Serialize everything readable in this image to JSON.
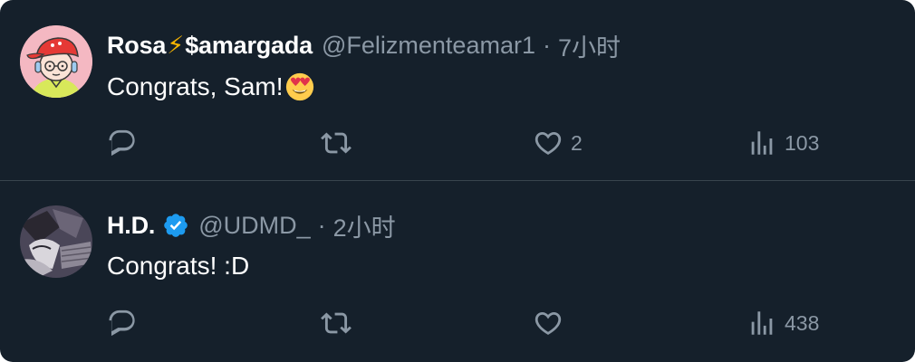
{
  "colors": {
    "background": "#15202b",
    "text_primary": "#ffffff",
    "text_secondary": "#8b98a5",
    "divider": "#38444d",
    "verified_blue": "#1d9bf0"
  },
  "tweets": [
    {
      "name": "Rosa",
      "name_emoji": "⚡",
      "name_suffix": "$amargada",
      "handle": "@Felizmenteamar1",
      "separator": "·",
      "time": "7小时",
      "verified": false,
      "text": "Congrats, Sam!",
      "text_emoji": "heart-eyes-emoji",
      "actions": {
        "reply_icon": "reply-icon",
        "retweet_icon": "retweet-icon",
        "like_icon": "heart-icon",
        "like_count": "2",
        "views_icon": "views-icon",
        "views_count": "103"
      }
    },
    {
      "name": "H.D.",
      "handle": "@UDMD_",
      "separator": "·",
      "time": "2小时",
      "verified": true,
      "text": "Congrats! :D",
      "actions": {
        "reply_icon": "reply-icon",
        "retweet_icon": "retweet-icon",
        "like_icon": "heart-icon",
        "like_count": "",
        "views_icon": "views-icon",
        "views_count": "438"
      }
    }
  ]
}
